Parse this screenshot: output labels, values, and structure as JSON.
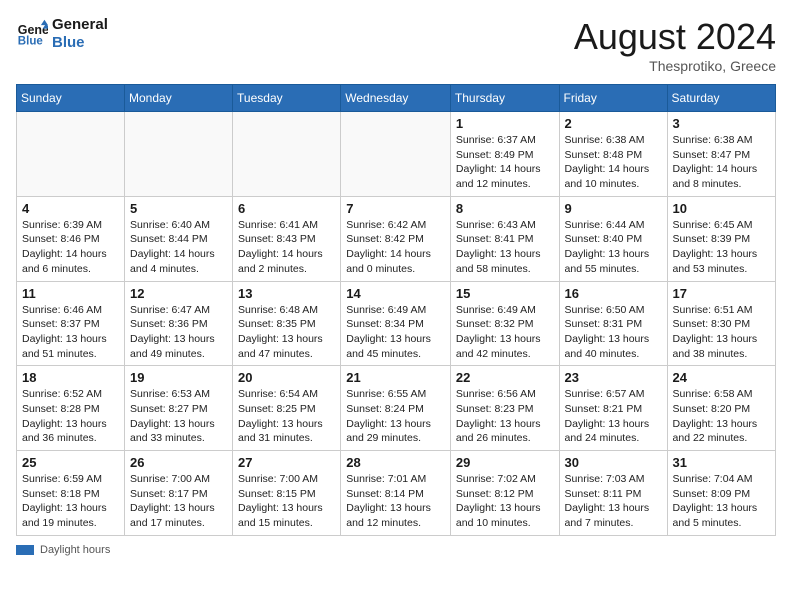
{
  "header": {
    "logo_line1": "General",
    "logo_line2": "Blue",
    "month_year": "August 2024",
    "location": "Thesprotiko, Greece"
  },
  "days_of_week": [
    "Sunday",
    "Monday",
    "Tuesday",
    "Wednesday",
    "Thursday",
    "Friday",
    "Saturday"
  ],
  "weeks": [
    [
      {
        "num": "",
        "info": ""
      },
      {
        "num": "",
        "info": ""
      },
      {
        "num": "",
        "info": ""
      },
      {
        "num": "",
        "info": ""
      },
      {
        "num": "1",
        "info": "Sunrise: 6:37 AM\nSunset: 8:49 PM\nDaylight: 14 hours and 12 minutes."
      },
      {
        "num": "2",
        "info": "Sunrise: 6:38 AM\nSunset: 8:48 PM\nDaylight: 14 hours and 10 minutes."
      },
      {
        "num": "3",
        "info": "Sunrise: 6:38 AM\nSunset: 8:47 PM\nDaylight: 14 hours and 8 minutes."
      }
    ],
    [
      {
        "num": "4",
        "info": "Sunrise: 6:39 AM\nSunset: 8:46 PM\nDaylight: 14 hours and 6 minutes."
      },
      {
        "num": "5",
        "info": "Sunrise: 6:40 AM\nSunset: 8:44 PM\nDaylight: 14 hours and 4 minutes."
      },
      {
        "num": "6",
        "info": "Sunrise: 6:41 AM\nSunset: 8:43 PM\nDaylight: 14 hours and 2 minutes."
      },
      {
        "num": "7",
        "info": "Sunrise: 6:42 AM\nSunset: 8:42 PM\nDaylight: 14 hours and 0 minutes."
      },
      {
        "num": "8",
        "info": "Sunrise: 6:43 AM\nSunset: 8:41 PM\nDaylight: 13 hours and 58 minutes."
      },
      {
        "num": "9",
        "info": "Sunrise: 6:44 AM\nSunset: 8:40 PM\nDaylight: 13 hours and 55 minutes."
      },
      {
        "num": "10",
        "info": "Sunrise: 6:45 AM\nSunset: 8:39 PM\nDaylight: 13 hours and 53 minutes."
      }
    ],
    [
      {
        "num": "11",
        "info": "Sunrise: 6:46 AM\nSunset: 8:37 PM\nDaylight: 13 hours and 51 minutes."
      },
      {
        "num": "12",
        "info": "Sunrise: 6:47 AM\nSunset: 8:36 PM\nDaylight: 13 hours and 49 minutes."
      },
      {
        "num": "13",
        "info": "Sunrise: 6:48 AM\nSunset: 8:35 PM\nDaylight: 13 hours and 47 minutes."
      },
      {
        "num": "14",
        "info": "Sunrise: 6:49 AM\nSunset: 8:34 PM\nDaylight: 13 hours and 45 minutes."
      },
      {
        "num": "15",
        "info": "Sunrise: 6:49 AM\nSunset: 8:32 PM\nDaylight: 13 hours and 42 minutes."
      },
      {
        "num": "16",
        "info": "Sunrise: 6:50 AM\nSunset: 8:31 PM\nDaylight: 13 hours and 40 minutes."
      },
      {
        "num": "17",
        "info": "Sunrise: 6:51 AM\nSunset: 8:30 PM\nDaylight: 13 hours and 38 minutes."
      }
    ],
    [
      {
        "num": "18",
        "info": "Sunrise: 6:52 AM\nSunset: 8:28 PM\nDaylight: 13 hours and 36 minutes."
      },
      {
        "num": "19",
        "info": "Sunrise: 6:53 AM\nSunset: 8:27 PM\nDaylight: 13 hours and 33 minutes."
      },
      {
        "num": "20",
        "info": "Sunrise: 6:54 AM\nSunset: 8:25 PM\nDaylight: 13 hours and 31 minutes."
      },
      {
        "num": "21",
        "info": "Sunrise: 6:55 AM\nSunset: 8:24 PM\nDaylight: 13 hours and 29 minutes."
      },
      {
        "num": "22",
        "info": "Sunrise: 6:56 AM\nSunset: 8:23 PM\nDaylight: 13 hours and 26 minutes."
      },
      {
        "num": "23",
        "info": "Sunrise: 6:57 AM\nSunset: 8:21 PM\nDaylight: 13 hours and 24 minutes."
      },
      {
        "num": "24",
        "info": "Sunrise: 6:58 AM\nSunset: 8:20 PM\nDaylight: 13 hours and 22 minutes."
      }
    ],
    [
      {
        "num": "25",
        "info": "Sunrise: 6:59 AM\nSunset: 8:18 PM\nDaylight: 13 hours and 19 minutes."
      },
      {
        "num": "26",
        "info": "Sunrise: 7:00 AM\nSunset: 8:17 PM\nDaylight: 13 hours and 17 minutes."
      },
      {
        "num": "27",
        "info": "Sunrise: 7:00 AM\nSunset: 8:15 PM\nDaylight: 13 hours and 15 minutes."
      },
      {
        "num": "28",
        "info": "Sunrise: 7:01 AM\nSunset: 8:14 PM\nDaylight: 13 hours and 12 minutes."
      },
      {
        "num": "29",
        "info": "Sunrise: 7:02 AM\nSunset: 8:12 PM\nDaylight: 13 hours and 10 minutes."
      },
      {
        "num": "30",
        "info": "Sunrise: 7:03 AM\nSunset: 8:11 PM\nDaylight: 13 hours and 7 minutes."
      },
      {
        "num": "31",
        "info": "Sunrise: 7:04 AM\nSunset: 8:09 PM\nDaylight: 13 hours and 5 minutes."
      }
    ]
  ],
  "footer": {
    "daylight_label": "Daylight hours"
  }
}
